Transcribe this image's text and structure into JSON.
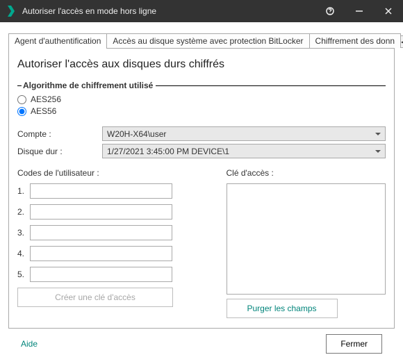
{
  "window": {
    "title": "Autoriser l'accès en mode hors ligne"
  },
  "tabs": {
    "agent": "Agent d'authentification",
    "bitlocker": "Accès au disque système avec protection BitLocker",
    "chiffrement": "Chiffrement des donn"
  },
  "page": {
    "heading": "Autoriser l'accès aux disques durs chiffrés",
    "algo_group": "Algorithme de chiffrement utilisé",
    "radio_aes256": "AES256",
    "radio_aes56": "AES56",
    "selected_algo": "AES56",
    "compte_label": "Compte :",
    "compte_value": "W20H-X64\\user",
    "disque_label": "Disque dur :",
    "disque_value": "1/27/2021 3:45:00 PM  DEVICE\\1",
    "codes_label": "Codes de l'utilisateur :",
    "codes_numbers": [
      "1.",
      "2.",
      "3.",
      "4.",
      "5."
    ],
    "access_label": "Clé d'accès :",
    "create_key_btn": "Créer une clé d'accès",
    "purge_btn": "Purger les champs"
  },
  "footer": {
    "help": "Aide",
    "close": "Fermer"
  }
}
